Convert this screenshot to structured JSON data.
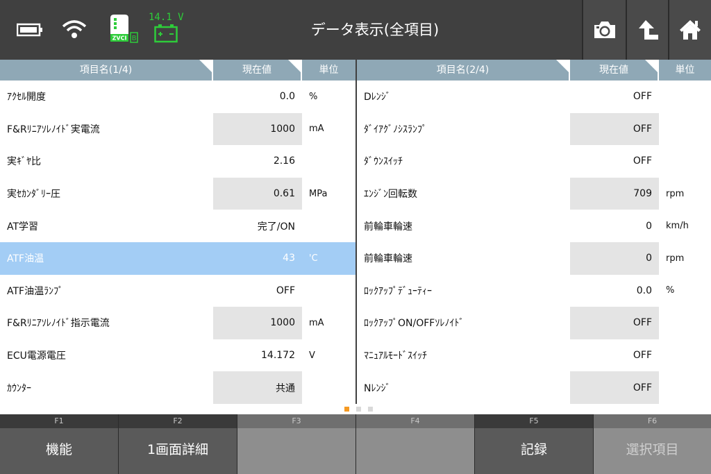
{
  "header": {
    "title": "データ表示(全項目)",
    "voltage": "14.1 V",
    "device_label": "ZVCI",
    "device_badge": "B",
    "icons": [
      "battery-icon",
      "wifi-icon",
      "vci-device-icon",
      "car-battery-icon",
      "camera-icon",
      "up-arrow-icon",
      "home-icon"
    ],
    "colors": {
      "bar": "#404040",
      "voltage": "#2ecc3a",
      "accent": "#f59a23"
    }
  },
  "left_table": {
    "headers": {
      "name": "項目名(1/4)",
      "value": "現在値",
      "unit": "単位"
    },
    "rows": [
      {
        "name": "ｱｸｾﾙ開度",
        "value": "0.0",
        "unit": "%"
      },
      {
        "name": "F&Rﾘﾆｱｿﾚﾉｲﾄﾞ実電流",
        "value": "1000",
        "unit": "mA"
      },
      {
        "name": "実ｷﾞﾔ比",
        "value": "2.16",
        "unit": ""
      },
      {
        "name": "実ｾｶﾝﾀﾞﾘｰ圧",
        "value": "0.61",
        "unit": "MPa"
      },
      {
        "name": "AT学習",
        "value": "完了/ON",
        "unit": ""
      },
      {
        "name": "ATF油温",
        "value": "43",
        "unit": "'C"
      },
      {
        "name": "ATF油温ﾗﾝﾌﾟ",
        "value": "OFF",
        "unit": ""
      },
      {
        "name": "F&Rﾘﾆｱｿﾚﾉｲﾄﾞ指示電流",
        "value": "1000",
        "unit": "mA"
      },
      {
        "name": "ECU電源電圧",
        "value": "14.172",
        "unit": "V"
      },
      {
        "name": "ｶｳﾝﾀｰ",
        "value": "共通",
        "unit": ""
      }
    ],
    "selected_index": 5
  },
  "right_table": {
    "headers": {
      "name": "項目名(2/4)",
      "value": "現在値",
      "unit": "単位"
    },
    "rows": [
      {
        "name": "Dﾚﾝｼﾞ",
        "value": "OFF",
        "unit": ""
      },
      {
        "name": "ﾀﾞｲｱｸﾞﾉｼｽﾗﾝﾌﾟ",
        "value": "OFF",
        "unit": ""
      },
      {
        "name": "ﾀﾞｳﾝｽｲｯﾁ",
        "value": "OFF",
        "unit": ""
      },
      {
        "name": "ｴﾝｼﾞﾝ回転数",
        "value": "709",
        "unit": "rpm"
      },
      {
        "name": "前輪車輪速",
        "value": "0",
        "unit": "km/h"
      },
      {
        "name": "前輪車輪速",
        "value": "0",
        "unit": "rpm"
      },
      {
        "name": "ﾛｯｸｱｯﾌﾟﾃﾞｭｰﾃｨｰ",
        "value": "0.0",
        "unit": "%"
      },
      {
        "name": "ﾛｯｸｱｯﾌﾟON/OFFｿﾚﾉｲﾄﾞ",
        "value": "OFF",
        "unit": ""
      },
      {
        "name": "ﾏﾆｭｱﾙﾓｰﾄﾞｽｲｯﾁ",
        "value": "OFF",
        "unit": ""
      },
      {
        "name": "Nﾚﾝｼﾞ",
        "value": "OFF",
        "unit": ""
      }
    ]
  },
  "pager": {
    "pages": 3,
    "active": 0
  },
  "footer": {
    "keys": [
      {
        "num": "F1",
        "label": "機能",
        "enabled": true
      },
      {
        "num": "F2",
        "label": "1画面詳細",
        "enabled": true
      },
      {
        "num": "F3",
        "label": "",
        "enabled": false
      },
      {
        "num": "F4",
        "label": "",
        "enabled": false
      },
      {
        "num": "F5",
        "label": "記録",
        "enabled": true
      },
      {
        "num": "F6",
        "label": "選択項目",
        "enabled": false
      }
    ]
  }
}
